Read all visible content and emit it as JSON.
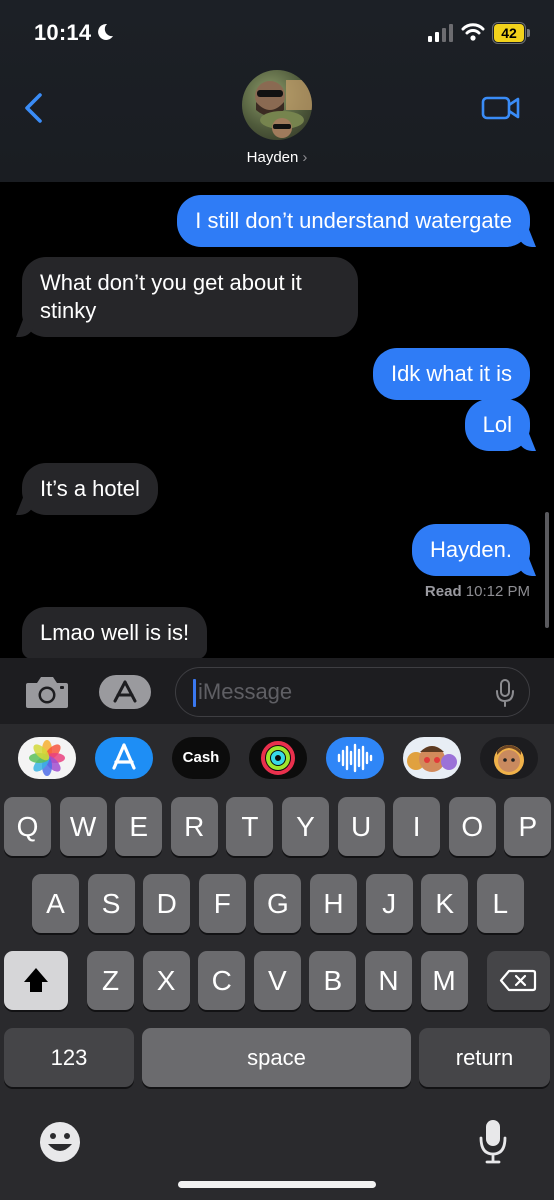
{
  "status_bar": {
    "time": "10:14",
    "battery": "42"
  },
  "header": {
    "contact_name": "Hayden",
    "chevron": "›"
  },
  "messages": [
    {
      "from": "me",
      "text": "I still don’t understand watergate"
    },
    {
      "from": "them",
      "text_line1": "What don’t you get about it",
      "text_line2": "stinky"
    },
    {
      "from": "me",
      "text": "Idk what it is"
    },
    {
      "from": "me",
      "text": "Lol"
    },
    {
      "from": "them",
      "text": "It’s a hotel"
    },
    {
      "from": "me",
      "text": "Hayden."
    },
    {
      "from": "them",
      "text": "Lmao well is is!"
    }
  ],
  "read_receipt": {
    "label": "Read",
    "time": "10:12 PM"
  },
  "compose": {
    "placeholder": "iMessage"
  },
  "app_drawer": {
    "cash_label": "Cash"
  },
  "keyboard": {
    "row1": [
      "Q",
      "W",
      "E",
      "R",
      "T",
      "Y",
      "U",
      "I",
      "O",
      "P"
    ],
    "row2": [
      "A",
      "S",
      "D",
      "F",
      "G",
      "H",
      "J",
      "K",
      "L"
    ],
    "row3": [
      "Z",
      "X",
      "C",
      "V",
      "B",
      "N",
      "M"
    ],
    "numbers_label": "123",
    "space_label": "space",
    "return_label": "return"
  },
  "colors": {
    "sent_bubble": "#2f7cf6",
    "received_bubble": "#262629",
    "accent": "#3a8cf7"
  }
}
